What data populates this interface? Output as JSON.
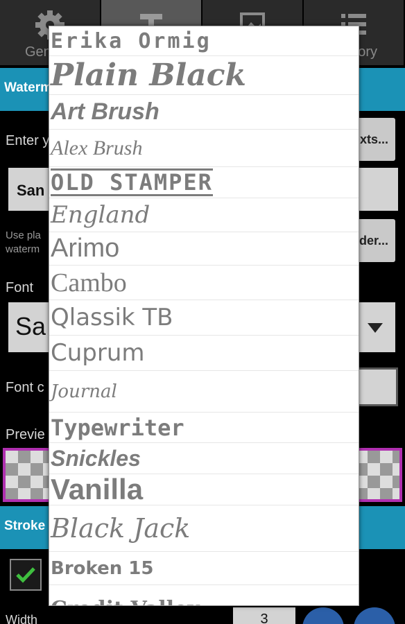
{
  "tabs": [
    {
      "label": "Gen",
      "icon": "gear-icon"
    },
    {
      "label": "",
      "icon": "text-icon"
    },
    {
      "label": "",
      "icon": "image-icon"
    },
    {
      "label": "ory",
      "icon": "list-icon"
    }
  ],
  "background": {
    "watermark_section": "Waterm",
    "enter_label": "Enter y",
    "texts_button": "xts...",
    "text_value": "San",
    "hint_line1": "Use pla",
    "hint_line2": "waterm",
    "order_button": "der...",
    "font_label": "Font",
    "font_value": "Sa",
    "font_color_label": "Font c",
    "preview_label": "Previe",
    "stroke_section": "Stroke",
    "width_label": "Width",
    "width_value": "3"
  },
  "font_list": [
    "Erika Ormig",
    "Plain Black",
    "Art Brush",
    "Alex Brush",
    "OLD STAMPER",
    "England",
    "Arimo",
    "Cambo",
    "Qlassik TB",
    "Cuprum",
    "Journal",
    "Typewriter",
    "Snickles",
    "Vanilla",
    "Black Jack",
    "Broken 15",
    "Credit Valley"
  ],
  "colors": {
    "section_bg": "#1b92b6",
    "check_green": "#3fbf3f",
    "preview_border": "#b030b0",
    "list_text": "#7c7c7c"
  }
}
